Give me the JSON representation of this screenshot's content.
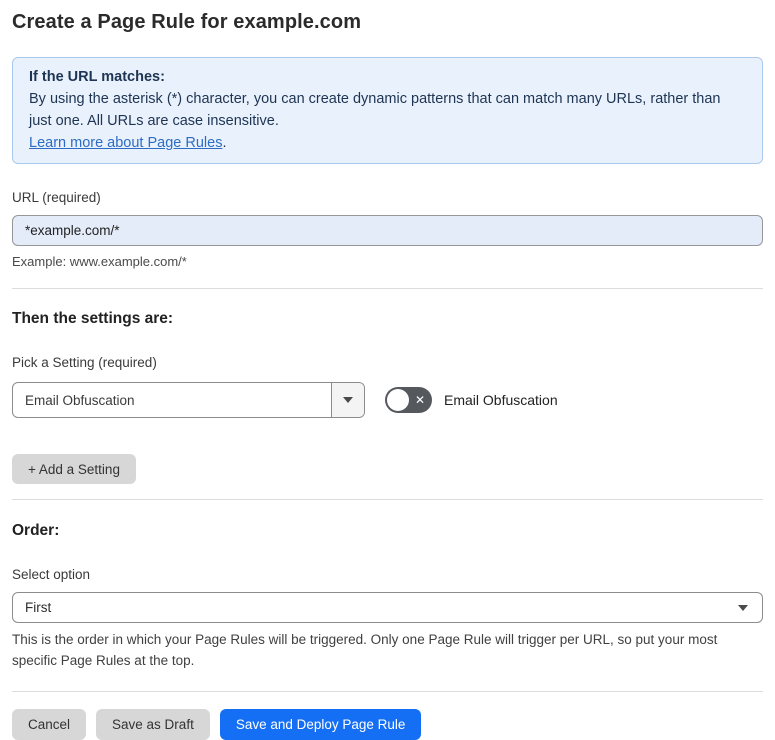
{
  "page": {
    "title": "Create a Page Rule for example.com"
  },
  "info_box": {
    "heading": "If the URL matches:",
    "body": "By using the asterisk (*) character, you can create dynamic patterns that can match many URLs, rather than just one. All URLs are case insensitive.",
    "link_label": "Learn more about Page Rules",
    "link_suffix": "."
  },
  "url_section": {
    "label": "URL (required)",
    "value": "*example.com/*",
    "example": "Example: www.example.com/*"
  },
  "settings_section": {
    "heading": "Then the settings are:",
    "picker_label": "Pick a Setting (required)",
    "picker_value": "Email Obfuscation",
    "toggle_state": "off",
    "toggle_label": "Email Obfuscation",
    "add_button_label": "+ Add a Setting"
  },
  "order_section": {
    "heading": "Order:",
    "select_label": "Select option",
    "select_value": "First",
    "description": "This is the order in which your Page Rules will be triggered. Only one Page Rule will trigger per URL, so put your most specific Page Rules at the top."
  },
  "footer": {
    "cancel_label": "Cancel",
    "save_draft_label": "Save as Draft",
    "save_deploy_label": "Save and Deploy Page Rule"
  },
  "icons": {
    "toggle_off_x": "✕"
  },
  "colors": {
    "primary_blue": "#156ff5",
    "info_bg": "#e9f2fc",
    "info_border": "#abc9ec",
    "info_text": "#1e3453",
    "input_bg": "#e4ecfa",
    "button_gray": "#d7d7d7",
    "link_blue": "#2d6cc4"
  }
}
